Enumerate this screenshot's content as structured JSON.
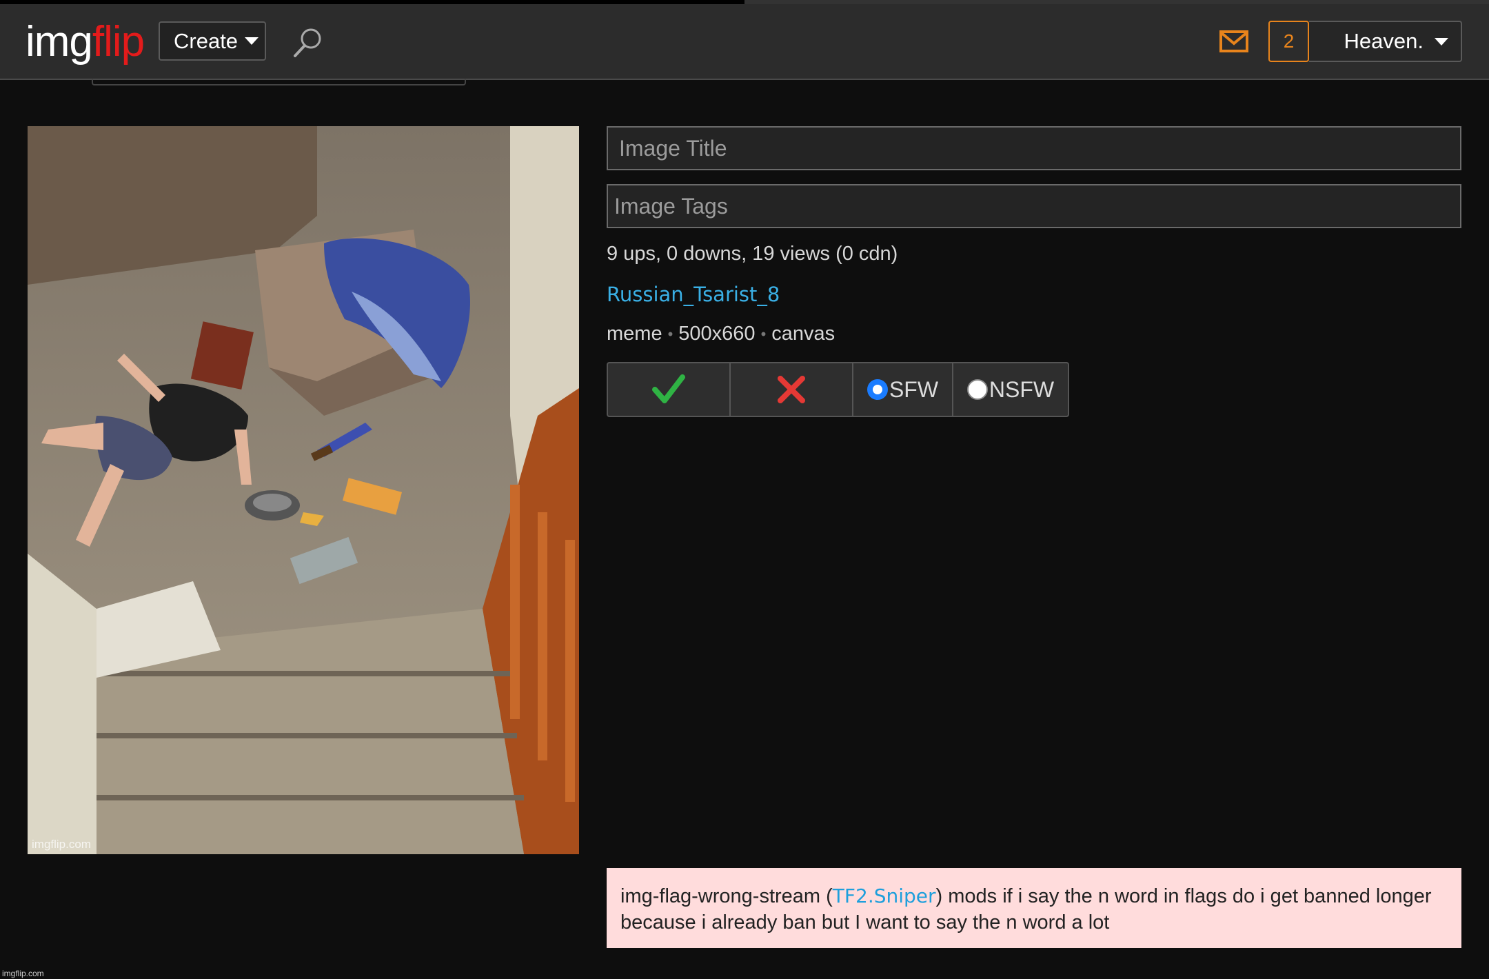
{
  "header": {
    "logo_part1": "img",
    "logo_part2": "flip",
    "create_label": "Create",
    "notification_count": "2",
    "username": "Heaven.",
    "page_load_progress": 0.5
  },
  "image": {
    "watermark": "imgflip.com"
  },
  "form": {
    "title_placeholder": "Image Title",
    "tags_placeholder": "Image Tags"
  },
  "stats": "9 ups, 0 downs, 19 views (0 cdn)",
  "author": "Russian_Tsarist_8",
  "meta": {
    "type": "meme",
    "separator": "•",
    "dimensions": "500x660",
    "source": "canvas"
  },
  "moderation": {
    "sfw_label": "SFW",
    "nsfw_label": "NSFW",
    "selected": "SFW"
  },
  "flag": {
    "prefix": "img-flag-wrong-stream (",
    "user": "TF2.Sniper",
    "message": ") mods if i say the n word in flags do i get banned longer because i already ban but I want to say the n word a lot"
  },
  "footer_watermark": "imgflip.com",
  "colors": {
    "header_bg": "#2c2c2c",
    "page_bg": "#0e0e0e",
    "logo_accent": "#e31b1b",
    "notification_accent": "#e8841c",
    "link": "#3ab0e6",
    "approve": "#2fb344",
    "reject": "#e53935",
    "radio_selected": "#1a7cff",
    "flag_bg": "#ffdcdc"
  }
}
